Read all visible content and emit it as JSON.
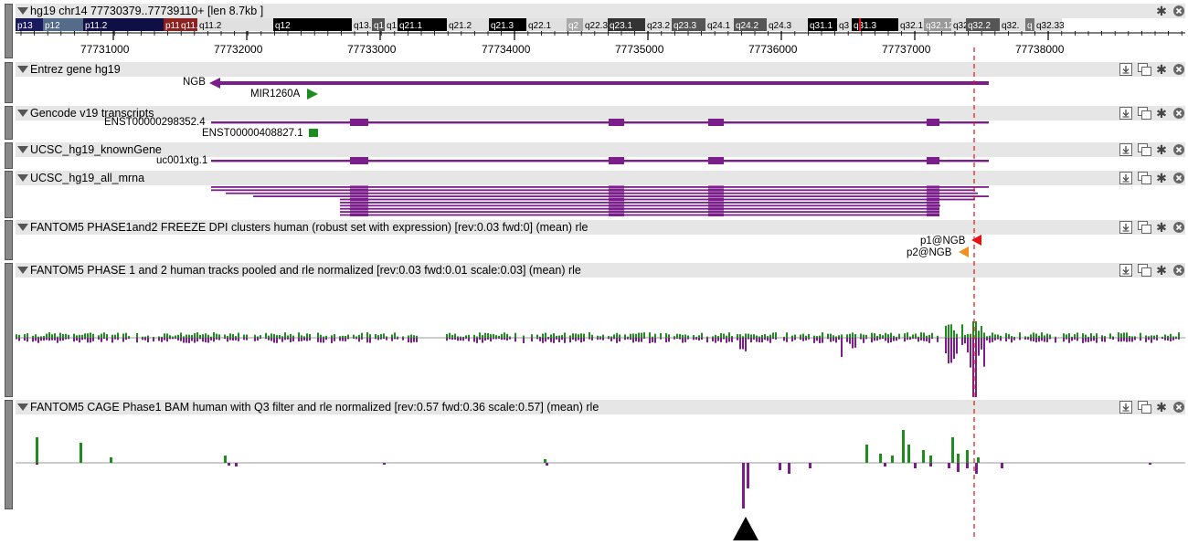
{
  "genome_header": {
    "title": "hg19 chr14 77730379..77739110+ [len 8.7kb ]",
    "bands": [
      {
        "name": "p13",
        "color": "#1a1a5e",
        "text_color": "#ffffff"
      },
      {
        "name": "p12",
        "color": "#556b8a",
        "text_color": "#ffffff"
      },
      {
        "name": "p11.2",
        "color": "#0f0f45",
        "text_color": "#ffffff"
      },
      {
        "name": "p11.1",
        "color": "#8b2020",
        "text_color": "#ffffff"
      },
      {
        "name": "q11.1",
        "color": "#8b2020",
        "text_color": "#ffffff"
      },
      {
        "name": "q11.2",
        "color": "#e0e0e0",
        "text_color": "#000000"
      },
      {
        "name": "q12",
        "color": "#000000",
        "text_color": "#ffffff"
      },
      {
        "name": "q13.",
        "color": "#e0e0e0",
        "text_color": "#000000"
      },
      {
        "name": "q1",
        "color": "#555555",
        "text_color": "#ffffff"
      },
      {
        "name": "q1",
        "color": "#e0e0e0",
        "text_color": "#000000"
      },
      {
        "name": "q21.1",
        "color": "#000000",
        "text_color": "#ffffff"
      },
      {
        "name": "q21.2",
        "color": "#e0e0e0",
        "text_color": "#000000"
      },
      {
        "name": "q21.3",
        "color": "#000000",
        "text_color": "#ffffff"
      },
      {
        "name": "q22.1",
        "color": "#e0e0e0",
        "text_color": "#000000"
      },
      {
        "name": "q2",
        "color": "#aaaaaa",
        "text_color": "#ffffff"
      },
      {
        "name": "q22.3",
        "color": "#e0e0e0",
        "text_color": "#000000"
      },
      {
        "name": "q23.1",
        "color": "#333333",
        "text_color": "#ffffff"
      },
      {
        "name": "q23.2",
        "color": "#e0e0e0",
        "text_color": "#000000"
      },
      {
        "name": "q23.3",
        "color": "#555555",
        "text_color": "#ffffff"
      },
      {
        "name": "q24.1",
        "color": "#e0e0e0",
        "text_color": "#000000"
      },
      {
        "name": "q24.2",
        "color": "#555555",
        "text_color": "#ffffff"
      },
      {
        "name": "q24.3",
        "color": "#e0e0e0",
        "text_color": "#000000"
      },
      {
        "name": "q31.1",
        "color": "#000000",
        "text_color": "#ffffff"
      },
      {
        "name": "q3",
        "color": "#e0e0e0",
        "text_color": "#000000"
      },
      {
        "name": "q31.3",
        "color": "#000000",
        "text_color": "#ffffff"
      },
      {
        "name": "q32.1",
        "color": "#e0e0e0",
        "text_color": "#000000"
      },
      {
        "name": "q32.12",
        "color": "#999999",
        "text_color": "#ffffff"
      },
      {
        "name": "q32",
        "color": "#e0e0e0",
        "text_color": "#000000"
      },
      {
        "name": "q32.2",
        "color": "#555555",
        "text_color": "#ffffff"
      },
      {
        "name": "q32.",
        "color": "#e0e0e0",
        "text_color": "#000000"
      },
      {
        "name": "q",
        "color": "#777777",
        "text_color": "#ffffff"
      },
      {
        "name": "q32.33",
        "color": "#e0e0e0",
        "text_color": "#000000"
      }
    ],
    "ruler_labels": [
      "77731000",
      "77732000",
      "77733000",
      "77734000",
      "77735000",
      "77736000",
      "77737000",
      "77738000"
    ]
  },
  "tracks": [
    {
      "id": "entrez",
      "title": "Entrez gene hg19",
      "features": [
        {
          "label": "NGB",
          "strand": "-",
          "color": "#7b1e8c"
        },
        {
          "label": "MIR1260A",
          "strand": "+",
          "color": "#1e8c1e"
        }
      ]
    },
    {
      "id": "gencode",
      "title": "Gencode v19 transcripts",
      "features": [
        {
          "label": "ENST00000298352.4",
          "color": "#7b1e8c"
        },
        {
          "label": "ENST00000408827.1",
          "color": "#1e8c1e"
        }
      ]
    },
    {
      "id": "knowngene",
      "title": "UCSC_hg19_knownGene",
      "features": [
        {
          "label": "uc001xtg.1",
          "color": "#7b1e8c"
        }
      ]
    },
    {
      "id": "mrna",
      "title": "UCSC_hg19_all_mrna",
      "mrna_count": 10
    },
    {
      "id": "dpi",
      "title": "FANTOM5 PHASE1and2 FREEZE DPI clusters human (robust set with expression) [rev:0.03 fwd:0] (mean) rle",
      "features": [
        {
          "label": "p1@NGB",
          "color": "#e81010"
        },
        {
          "label": "p2@NGB",
          "color": "#f0901e"
        }
      ]
    },
    {
      "id": "pooled",
      "title": "FANTOM5 PHASE 1 and 2 human tracks pooled and rle normalized [rev:0.03 fwd:0.01 scale:0.03] (mean) rle"
    },
    {
      "id": "cage",
      "title": "FANTOM5 CAGE Phase1 BAM human with Q3 filter and rle normalized [rev:0.57 fwd:0.36 scale:0.57] (mean) rle"
    }
  ],
  "colors": {
    "forward": "#1e8c1e",
    "reverse": "#7b1e8c",
    "header_bg": "#e6e6e6",
    "marker_line": "#e81010"
  },
  "icons": [
    "download-icon",
    "window-icon",
    "gear-icon",
    "close-icon",
    "collapse-triangle-icon",
    "arrow-marker-icon"
  ]
}
